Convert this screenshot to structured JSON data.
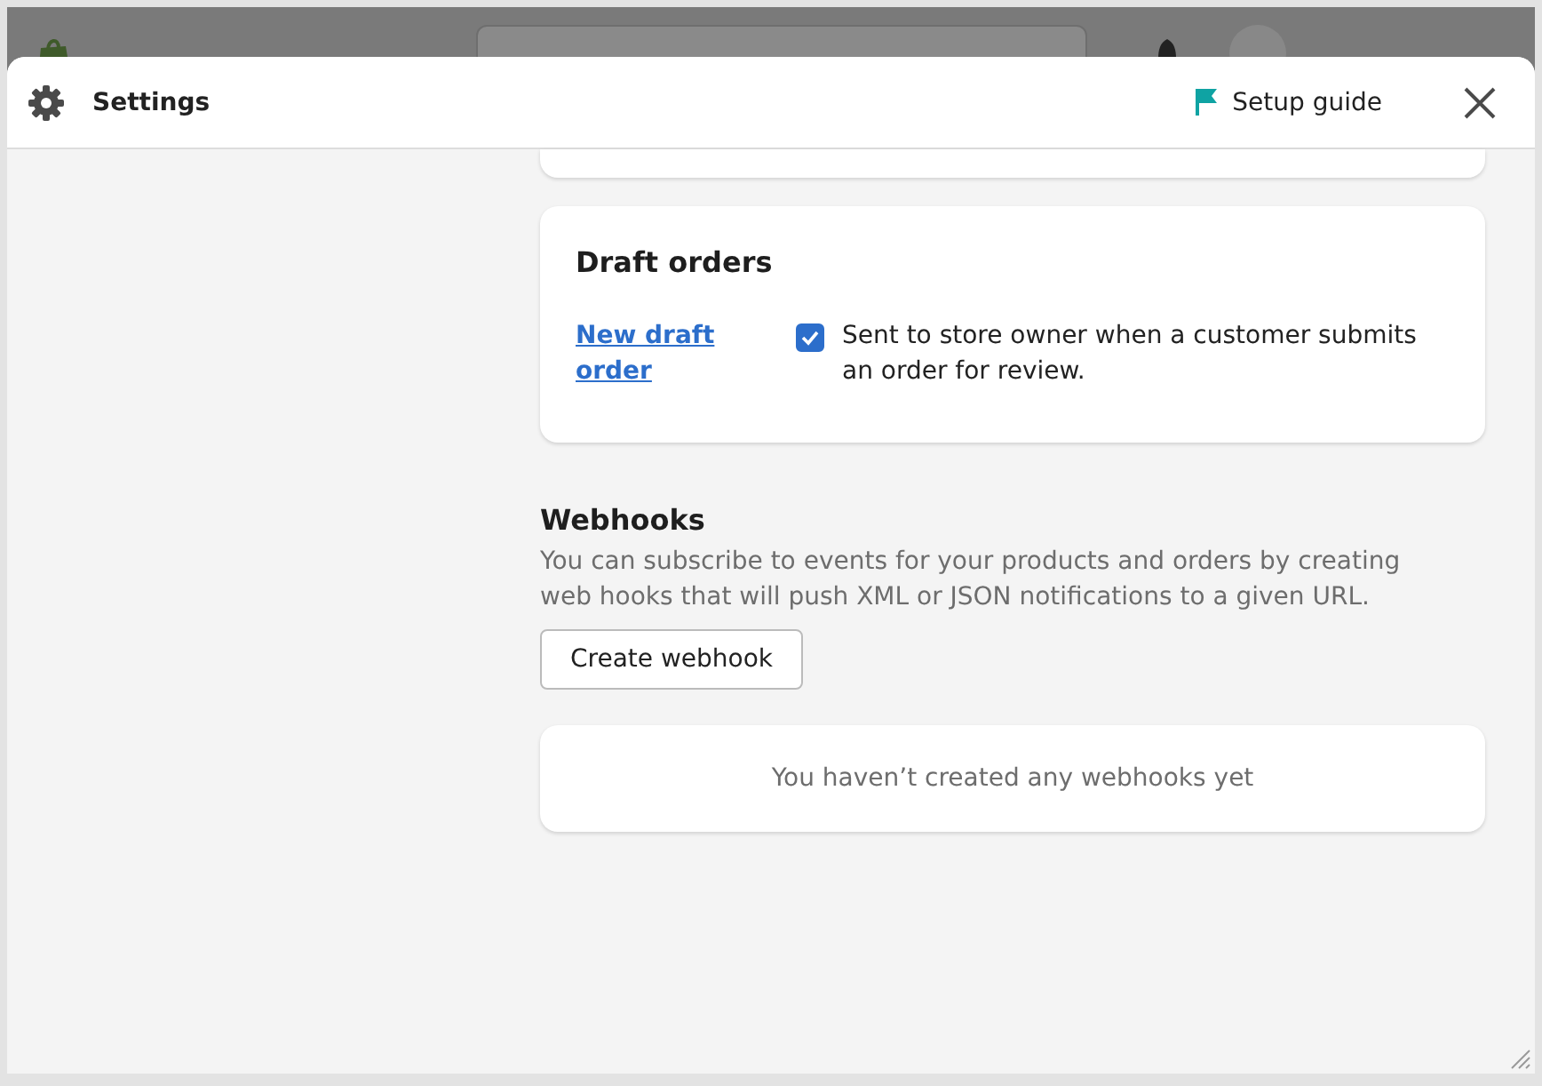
{
  "window": {
    "title": "Settings",
    "setup_guide": "Setup guide"
  },
  "draft_orders": {
    "title": "Draft orders",
    "notifications": [
      {
        "label": "New draft order",
        "checked": true,
        "description": "Sent to store owner when a customer submits an order for review."
      }
    ]
  },
  "webhooks": {
    "title": "Webhooks",
    "description": "You can subscribe to events for your products and orders by creating web hooks that will push XML or JSON notifications to a given URL.",
    "button": "Create webhook",
    "empty_message": "You haven’t created any webhooks yet"
  }
}
